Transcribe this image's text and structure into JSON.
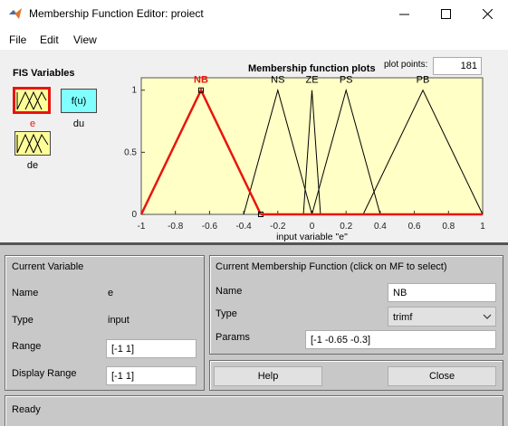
{
  "window": {
    "title": "Membership Function Editor: proiect",
    "minimize_icon": "minimize-icon",
    "maximize_icon": "maximize-icon",
    "close_icon": "close-icon"
  },
  "menu": {
    "file": "File",
    "edit": "Edit",
    "view": "View"
  },
  "fis": {
    "title": "FIS Variables",
    "inputs": [
      {
        "name": "e",
        "selected": true
      },
      {
        "name": "de",
        "selected": false
      }
    ],
    "output": {
      "name": "du",
      "box_label": "f(u)"
    }
  },
  "plot": {
    "title": "Membership function plots",
    "plot_points_label": "plot points:",
    "plot_points_value": "181"
  },
  "chart_data": {
    "type": "line",
    "title": "Membership function plots",
    "xlabel": "input variable \"e\"",
    "ylabel": "",
    "xlim": [
      -1,
      1
    ],
    "ylim": [
      0,
      1.1
    ],
    "xticks": [
      "-1",
      "-0.8",
      "-0.6",
      "-0.4",
      "-0.2",
      "0",
      "0.2",
      "0.4",
      "0.6",
      "0.8",
      "1"
    ],
    "yticks": [
      "0",
      "0.5",
      "1"
    ],
    "series": [
      {
        "name": "NB",
        "x": [
          -1,
          -0.65,
          -0.3
        ],
        "y": [
          0,
          1,
          0
        ],
        "selected": true
      },
      {
        "name": "NS",
        "x": [
          -0.4,
          -0.2,
          0
        ],
        "y": [
          0,
          1,
          0
        ]
      },
      {
        "name": "ZE",
        "x": [
          -0.05,
          0,
          0.05
        ],
        "y": [
          0,
          1,
          0
        ]
      },
      {
        "name": "PS",
        "x": [
          0,
          0.2,
          0.4
        ],
        "y": [
          0,
          1,
          0
        ]
      },
      {
        "name": "PB",
        "x": [
          0.3,
          0.65,
          1
        ],
        "y": [
          0,
          1,
          0
        ]
      }
    ],
    "colors": {
      "selected": "#e8150d",
      "normal": "#000000",
      "background": "#ffffc6"
    }
  },
  "current_variable": {
    "heading": "Current Variable",
    "name_label": "Name",
    "name_value": "e",
    "type_label": "Type",
    "type_value": "input",
    "range_label": "Range",
    "range_value": "[-1 1]",
    "display_range_label": "Display Range",
    "display_range_value": "[-1 1]"
  },
  "current_mf": {
    "heading": "Current Membership Function (click on MF to select)",
    "name_label": "Name",
    "name_value": "NB",
    "type_label": "Type",
    "type_value": "trimf",
    "params_label": "Params",
    "params_value": "[-1 -0.65 -0.3]"
  },
  "buttons": {
    "help": "Help",
    "close": "Close"
  },
  "status": {
    "text": "Ready"
  }
}
